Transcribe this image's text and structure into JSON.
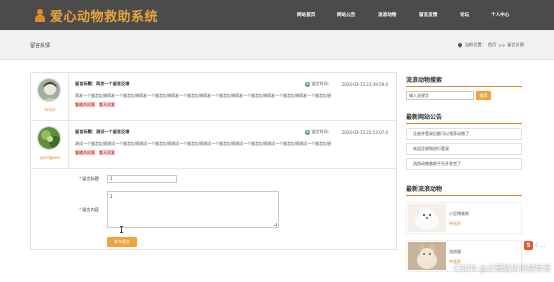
{
  "header": {
    "logo_text": "爱心动物救助系统",
    "nav": [
      "网站首页",
      "网站公告",
      "流浪动物",
      "留言反馈",
      "论坛",
      "个人中心"
    ]
  },
  "breadcrumb": {
    "title": "留言反馈",
    "location_label": "当前位置：",
    "home": "首页",
    "separator": ">>",
    "current": "留言反馈"
  },
  "messages": [
    {
      "avatar_user": "fuliye",
      "title_label": "留言标题：",
      "title": "再发一个留言反馈",
      "time_label": "留言时间：",
      "time": "2024-03-15 23:39:59.0",
      "content": "再发一个留言反馈再发一个留言反馈再发一个留言反馈再发一个留言反馈再发一个留言反馈再发一个留言反馈再发一个留言反馈再发一个留言反馈",
      "reply": "管理员回复：暂无回复"
    },
    {
      "avatar_user": "goodgood",
      "title_label": "留言标题：",
      "title": "测试一个留言反馈",
      "time_label": "留言时间：",
      "time": "2024-03-15 22:53:07.0",
      "content": "测试一个留言反馈测试一个留言反馈测试一个留言反馈测试一个留言反馈测试一个留言反馈测试一个留言反馈测试一个留言反馈测试一个留言反馈",
      "reply": "管理员回复：暂无回复"
    }
  ],
  "form": {
    "title_label": "留言标题",
    "title_value": "1",
    "content_label": "留言内容",
    "content_value": "1",
    "submit_label": "发布留言",
    "required_mark": "*"
  },
  "sidebar": {
    "search_title": "流浪动物搜索",
    "search_placeholder": "输入关键字",
    "search_button": "搜索",
    "notice_title": "最新网站公告",
    "notices": [
      "注册并登录后能可以领养动物了",
      "欢迎注册和进行登录",
      "流浪动物救助平台开发完了"
    ],
    "animal_title": "最新流浪动物",
    "animals": [
      {
        "name": "小型博美狗",
        "tag": "待领养"
      },
      {
        "name": "流浪猫",
        "tag": "待领养"
      }
    ]
  },
  "watermark": "CSDN @计算机毕设辅导员",
  "colors": {
    "header_bg": "#4c4b4b",
    "accent": "#f0a33a",
    "reply": "#d9372b"
  }
}
